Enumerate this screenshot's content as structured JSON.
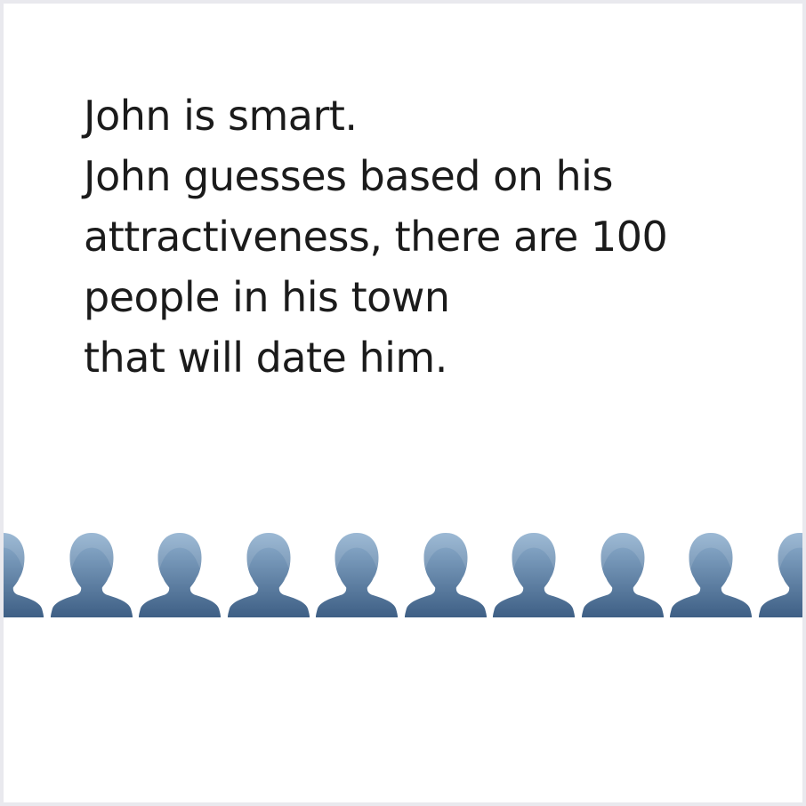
{
  "text": {
    "lines": [
      "John is smart.",
      "John guesses based on his",
      "attractiveness, there are 100",
      "people in his town",
      "that will date him."
    ]
  },
  "crowd": {
    "icon": "person-silhouette-icon",
    "count": 10,
    "color_top": "#8fb0cf",
    "color_bottom": "#3e5f85"
  }
}
